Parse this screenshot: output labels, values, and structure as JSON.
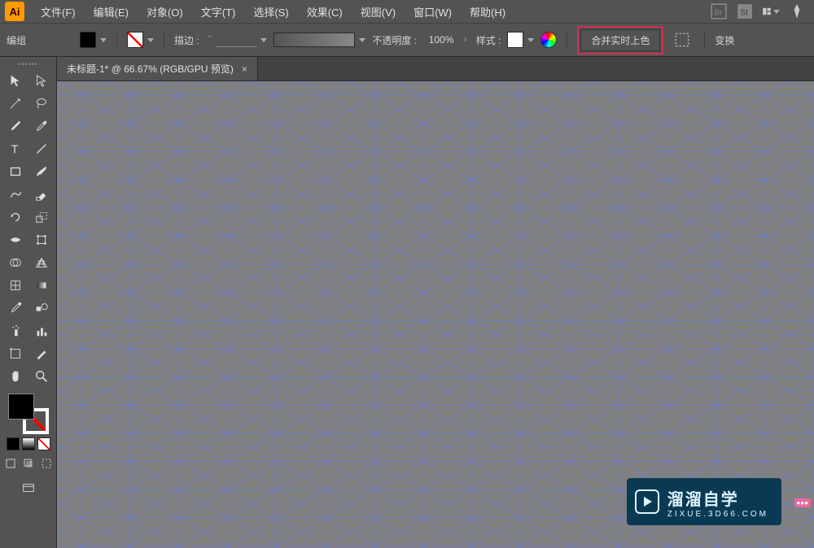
{
  "app": {
    "logo": "Ai"
  },
  "menu": {
    "file": "文件(F)",
    "edit": "编辑(E)",
    "object": "对象(O)",
    "type": "文字(T)",
    "select": "选择(S)",
    "effect": "效果(C)",
    "view": "视图(V)",
    "window": "窗口(W)",
    "help": "帮助(H)"
  },
  "control": {
    "context": "编组",
    "stroke_label": "描边 :",
    "opacity_label": "不透明度 :",
    "opacity_value": "100%",
    "style_label": "样式 :",
    "merge_label": "合并实时上色",
    "transform_label": "变换",
    "fill_color": "#000000",
    "stroke_color": "none",
    "style_swatch": "#ffffff"
  },
  "document": {
    "tab_title": "未标题-1* @ 66.67% (RGB/GPU 预览)",
    "zoom": "66.67%",
    "color_mode": "RGB/GPU 预览"
  },
  "tools": {
    "left_column": [
      "selection",
      "pen",
      "curvature",
      "type",
      "rectangle",
      "paintbrush",
      "rotate",
      "width",
      "shape-builder",
      "perspective",
      "mesh",
      "eyedropper",
      "blend",
      "artboard",
      "hand"
    ],
    "right_column": [
      "direct-selection",
      "magic-wand",
      "add-anchor",
      "line",
      "ellipse",
      "eraser",
      "scale",
      "free-transform",
      "live-paint",
      "gradient",
      "scissors",
      "symbol-sprayer",
      "column-graph",
      "slice",
      "zoom"
    ]
  },
  "watermark": {
    "title": "溜溜自学",
    "subtitle": "ZIXUE.3D66.COM"
  },
  "colors": {
    "canvas_bg": "#808080",
    "grid_line": "#6b7dd6",
    "ui_bg": "#535353",
    "highlight": "#d03050"
  }
}
